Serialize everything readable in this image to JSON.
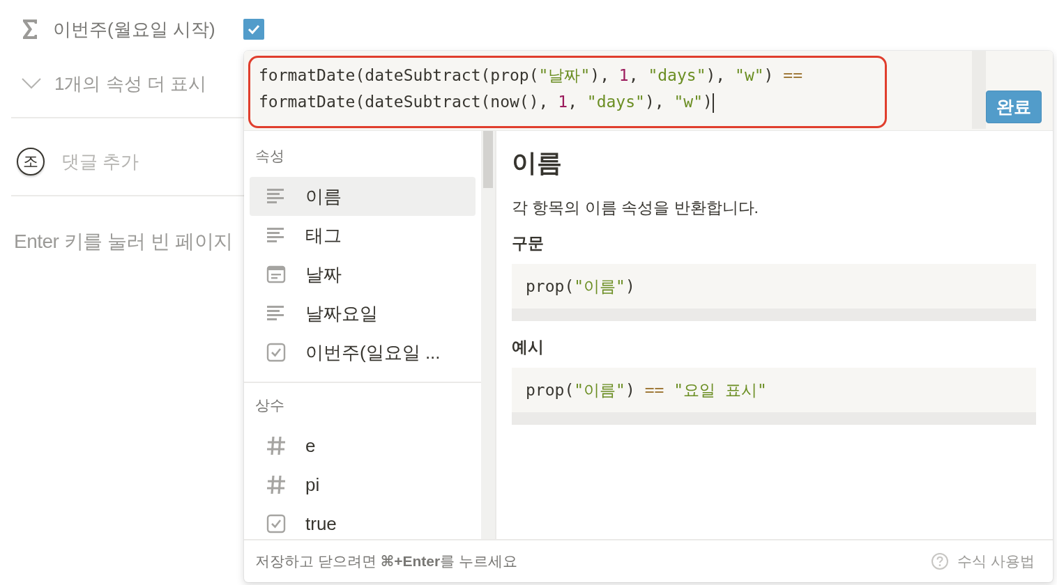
{
  "property": {
    "label": "이번주(월요일 시작)",
    "checked": true
  },
  "more_properties": {
    "label": "1개의 속성 더 표시"
  },
  "comment": {
    "avatar": "조",
    "placeholder": "댓글 추가"
  },
  "page_hint": "Enter 키를 눌러 빈 페이지",
  "formula_editor": {
    "lines": [
      [
        {
          "kind": "plain",
          "text": "formatDate(dateSubtract(prop("
        },
        {
          "kind": "string",
          "text": "\"날짜\""
        },
        {
          "kind": "plain",
          "text": "), "
        },
        {
          "kind": "number",
          "text": "1"
        },
        {
          "kind": "plain",
          "text": ", "
        },
        {
          "kind": "string",
          "text": "\"days\""
        },
        {
          "kind": "plain",
          "text": "), "
        },
        {
          "kind": "string",
          "text": "\"w\""
        },
        {
          "kind": "plain",
          "text": ") "
        },
        {
          "kind": "operator",
          "text": "=="
        }
      ],
      [
        {
          "kind": "plain",
          "text": "formatDate(dateSubtract(now(), "
        },
        {
          "kind": "number",
          "text": "1"
        },
        {
          "kind": "plain",
          "text": ", "
        },
        {
          "kind": "string",
          "text": "\"days\""
        },
        {
          "kind": "plain",
          "text": "), "
        },
        {
          "kind": "string",
          "text": "\"w\""
        },
        {
          "kind": "plain",
          "text": ")"
        }
      ]
    ],
    "done_button": "완료"
  },
  "sections": [
    {
      "title": "속성",
      "items": [
        {
          "kind": "text",
          "label": "이름",
          "selected": true
        },
        {
          "kind": "text",
          "label": "태그",
          "selected": false
        },
        {
          "kind": "date",
          "label": "날짜",
          "selected": false
        },
        {
          "kind": "text",
          "label": "날짜요일",
          "selected": false
        },
        {
          "kind": "checkbox",
          "label": "이번주(일요일 ...",
          "selected": false
        }
      ]
    },
    {
      "title": "상수",
      "items": [
        {
          "kind": "number",
          "label": "e",
          "selected": false
        },
        {
          "kind": "number",
          "label": "pi",
          "selected": false
        },
        {
          "kind": "checkbox",
          "label": "true",
          "selected": false
        }
      ]
    }
  ],
  "detail": {
    "title": "이름",
    "description": "각 항목의 이름 속성을 반환합니다.",
    "blocks": [
      {
        "heading": "구문",
        "code": [
          {
            "kind": "plain",
            "text": "prop("
          },
          {
            "kind": "string",
            "text": "\"이름\""
          },
          {
            "kind": "plain",
            "text": ")"
          }
        ]
      },
      {
        "heading": "예시",
        "code": [
          {
            "kind": "plain",
            "text": "prop("
          },
          {
            "kind": "string",
            "text": "\"이름\""
          },
          {
            "kind": "plain",
            "text": ") "
          },
          {
            "kind": "operator",
            "text": "=="
          },
          {
            "kind": "string",
            "text": " \"요일 표시\""
          }
        ]
      }
    ]
  },
  "footer": {
    "hint": "저장하고 닫으려면 **⌘+Enter**를 누르세요",
    "help_link": "수식 사용법"
  }
}
